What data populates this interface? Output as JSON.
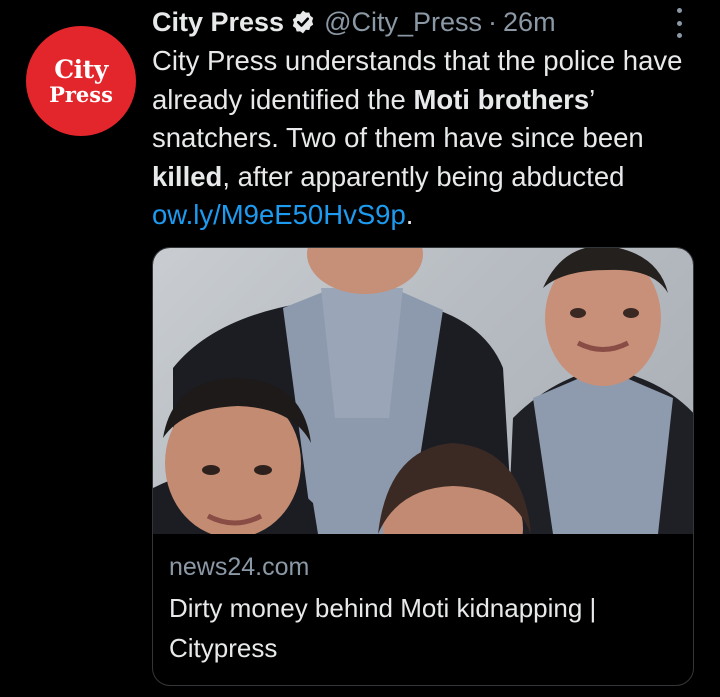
{
  "account": {
    "avatar_line1": "City",
    "avatar_line2": "Press",
    "name": "City Press",
    "handle": "@City_Press",
    "separator": "·",
    "time": "26m",
    "verified": true
  },
  "tweet": {
    "t1": "City Press understands that the police have already identified the ",
    "t2": "Moti brothers",
    "t3": "’ snatchers. Two of them have since been ",
    "t4": "killed",
    "t5": ", after apparently being abducted ",
    "link": "ow.ly/M9eE50HvS9p",
    "t6": "."
  },
  "card": {
    "domain": "news24.com",
    "title": "Dirty money behind Moti kidnapping | Citypress"
  },
  "colors": {
    "background": "#000000",
    "avatar_red": "#e3262c",
    "link_blue": "#1d9bf0",
    "secondary_text": "#8b98a5"
  },
  "icons": [
    "verified-badge-icon",
    "more-options-icon"
  ]
}
